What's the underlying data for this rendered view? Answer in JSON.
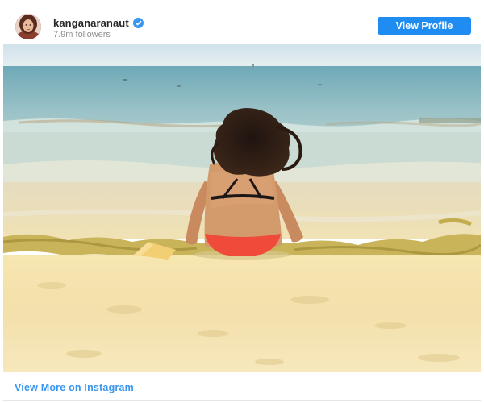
{
  "account": {
    "username": "kanganaranaut",
    "followers": "7.9m followers",
    "verified": true
  },
  "header": {
    "view_profile_label": "View Profile"
  },
  "footer": {
    "view_more_label": "View More on Instagram"
  },
  "icons": {
    "verified": "verified-badge-icon",
    "avatar": "profile-avatar"
  },
  "colors": {
    "accent": "#1e8cf0",
    "link": "#3897f0",
    "username": "#262626",
    "muted": "#8e8e8e"
  }
}
